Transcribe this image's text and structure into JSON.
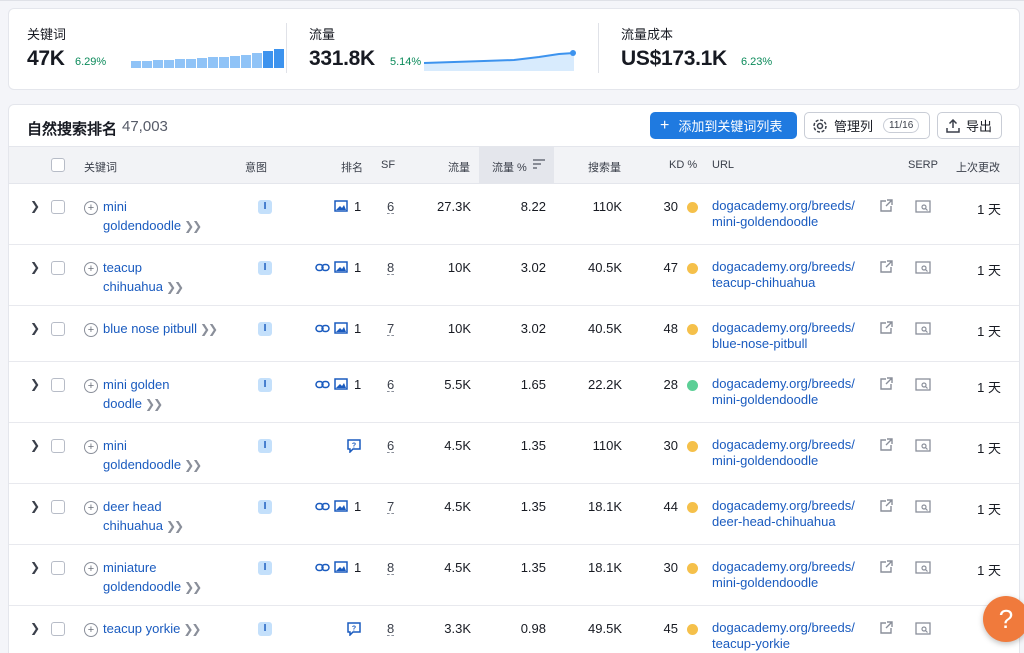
{
  "metrics": {
    "keywords": {
      "label": "关键词",
      "value": "47K",
      "delta": "6.29%",
      "bars": [
        0.35,
        0.35,
        0.4,
        0.4,
        0.45,
        0.45,
        0.5,
        0.55,
        0.55,
        0.6,
        0.65,
        0.75,
        0.85,
        0.95
      ]
    },
    "traffic": {
      "label": "流量",
      "value": "331.8K",
      "delta": "5.14%"
    },
    "cost": {
      "label": "流量成本",
      "value": "US$173.1K",
      "delta": "6.23%"
    }
  },
  "table": {
    "title": "自然搜索排名",
    "count": "47,003",
    "add_button": "添加到关键词列表",
    "columns_button": "管理列",
    "columns_pill": "11/16",
    "export_button": "导出",
    "headers": {
      "keyword": "关键词",
      "intent": "意图",
      "rank": "排名",
      "sf": "SF",
      "traffic": "流量",
      "traffic_pct": "流量 %",
      "volume": "搜索量",
      "kd": "KD %",
      "url": "URL",
      "serp": "SERP",
      "updated": "上次更改"
    },
    "rows": [
      {
        "kw1": "mini",
        "kw2": "goldendoodle",
        "intent": "I",
        "icons": [
          "image"
        ],
        "rank": "1",
        "sf": "6",
        "traffic": "27.3K",
        "pct": "8.22",
        "volume": "110K",
        "kd": "30",
        "kd_color": "#f5c04a",
        "url1": "dogacademy.org/breeds/",
        "url2": "mini-goldendoodle",
        "updated": "1 天"
      },
      {
        "kw1": "teacup",
        "kw2": "chihuahua",
        "intent": "I",
        "icons": [
          "link",
          "image"
        ],
        "rank": "1",
        "sf": "8",
        "traffic": "10K",
        "pct": "3.02",
        "volume": "40.5K",
        "kd": "47",
        "kd_color": "#f5c04a",
        "url1": "dogacademy.org/breeds/",
        "url2": "teacup-chihuahua",
        "updated": "1 天"
      },
      {
        "kw1": "blue nose pitbull",
        "kw2": "",
        "intent": "I",
        "icons": [
          "link",
          "image"
        ],
        "rank": "1",
        "sf": "7",
        "traffic": "10K",
        "pct": "3.02",
        "volume": "40.5K",
        "kd": "48",
        "kd_color": "#f5c04a",
        "url1": "dogacademy.org/breeds/",
        "url2": "blue-nose-pitbull",
        "updated": "1 天"
      },
      {
        "kw1": "mini golden",
        "kw2": "doodle",
        "intent": "I",
        "icons": [
          "link",
          "image"
        ],
        "rank": "1",
        "sf": "6",
        "traffic": "5.5K",
        "pct": "1.65",
        "volume": "22.2K",
        "kd": "28",
        "kd_color": "#5ccf96",
        "url1": "dogacademy.org/breeds/",
        "url2": "mini-goldendoodle",
        "updated": "1 天"
      },
      {
        "kw1": "mini",
        "kw2": "goldendoodle",
        "intent": "I",
        "icons": [
          "faq"
        ],
        "rank": "",
        "sf": "6",
        "traffic": "4.5K",
        "pct": "1.35",
        "volume": "110K",
        "kd": "30",
        "kd_color": "#f5c04a",
        "url1": "dogacademy.org/breeds/",
        "url2": "mini-goldendoodle",
        "updated": "1 天"
      },
      {
        "kw1": "deer head",
        "kw2": "chihuahua",
        "intent": "I",
        "icons": [
          "link",
          "image"
        ],
        "rank": "1",
        "sf": "7",
        "traffic": "4.5K",
        "pct": "1.35",
        "volume": "18.1K",
        "kd": "44",
        "kd_color": "#f5c04a",
        "url1": "dogacademy.org/breeds/",
        "url2": "deer-head-chihuahua",
        "updated": "1 天"
      },
      {
        "kw1": "miniature",
        "kw2": "goldendoodle",
        "intent": "I",
        "icons": [
          "link",
          "image"
        ],
        "rank": "1",
        "sf": "8",
        "traffic": "4.5K",
        "pct": "1.35",
        "volume": "18.1K",
        "kd": "30",
        "kd_color": "#f5c04a",
        "url1": "dogacademy.org/breeds/",
        "url2": "mini-goldendoodle",
        "updated": "1 天"
      },
      {
        "kw1": "teacup yorkie",
        "kw2": "",
        "intent": "I",
        "icons": [
          "faq"
        ],
        "rank": "",
        "sf": "8",
        "traffic": "3.3K",
        "pct": "0.98",
        "volume": "49.5K",
        "kd": "45",
        "kd_color": "#f5c04a",
        "url1": "dogacademy.org/breeds/",
        "url2": "teacup-yorkie",
        "updated": "1"
      }
    ]
  },
  "help_button": "?"
}
